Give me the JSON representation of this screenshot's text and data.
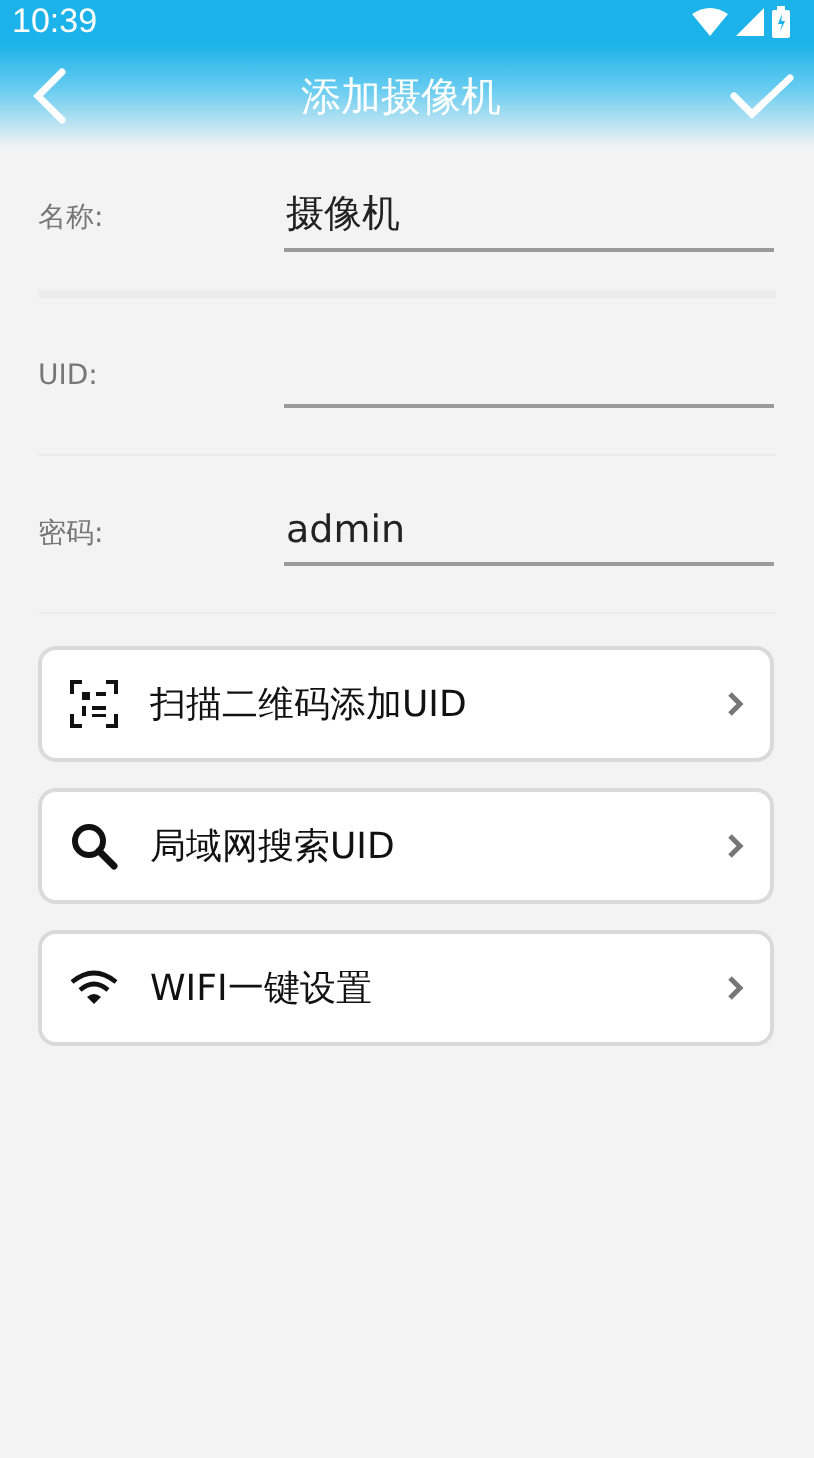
{
  "status_bar": {
    "time": "10:39"
  },
  "header": {
    "title": "添加摄像机"
  },
  "fields": [
    {
      "label": "名称:",
      "value": "摄像机"
    },
    {
      "label": "UID:"
    },
    {
      "label": "密码:",
      "value": "admin"
    }
  ],
  "actions": [
    {
      "kind": "qr",
      "label": "扫描二维码添加UID"
    },
    {
      "kind": "search",
      "label": "局域网搜索UID"
    },
    {
      "kind": "wifi",
      "label": "WIFI一键设置"
    }
  ]
}
